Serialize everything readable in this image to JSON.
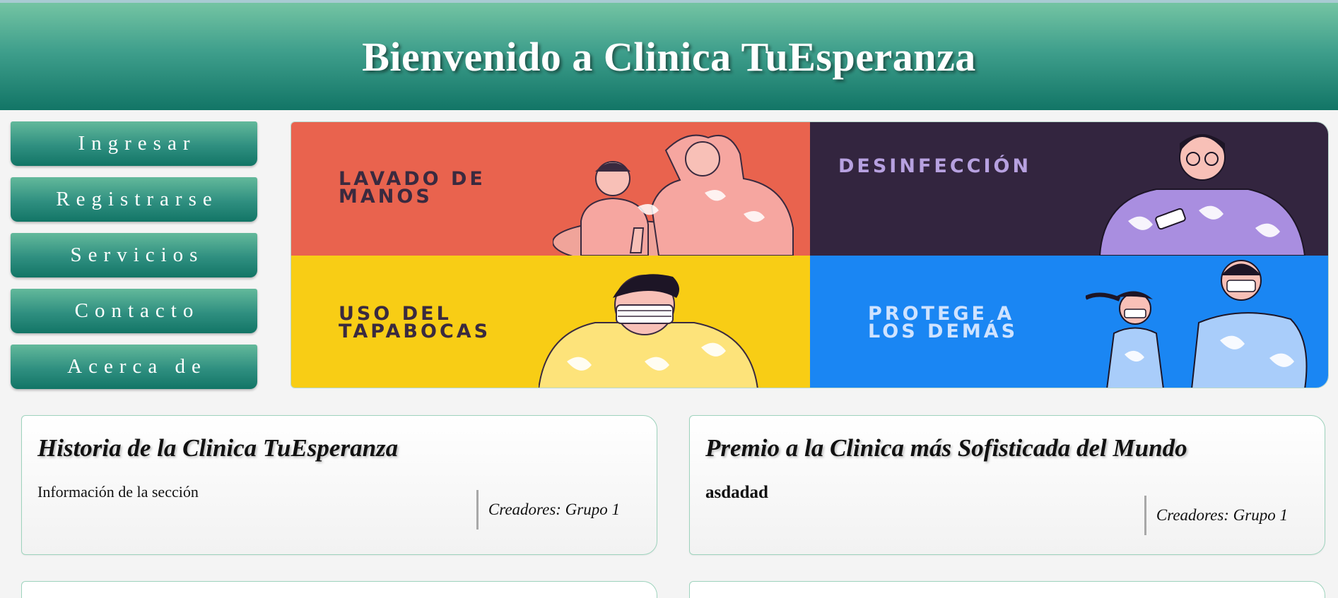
{
  "header": {
    "title": "Bienvenido a Clinica TuEsperanza"
  },
  "nav": {
    "items": [
      {
        "label": "Ingresar"
      },
      {
        "label": "Registrarse"
      },
      {
        "label": "Servicios"
      },
      {
        "label": "Contacto"
      },
      {
        "label": "Acerca de"
      }
    ]
  },
  "banner": {
    "panels": [
      {
        "label": "LAVADO DE\nMANOS",
        "color": "#e9634e",
        "text_color": "#3a2a3f"
      },
      {
        "label": "DESINFECCIÓN",
        "color": "#33253f",
        "text_color": "#b7a1e0"
      },
      {
        "label": "USO DEL\nTAPABOCAS",
        "color": "#f8cd15",
        "text_color": "#3a2a3f"
      },
      {
        "label": "PROTEGE A\nLOS DEMÁS",
        "color": "#1a86f3",
        "text_color": "#cfe3ff"
      }
    ]
  },
  "cards": [
    {
      "title": "Historia de la Clinica TuEsperanza",
      "info": "Información de la sección",
      "credits": "Creadores: Grupo 1"
    },
    {
      "title": "Premio a la Clinica más Sofisticada del Mundo",
      "info": "asdadad",
      "credits": "Creadores: Grupo 1"
    }
  ],
  "colors": {
    "header_top": "#74c4a3",
    "header_bottom": "#127566",
    "card_border": "#9ed3bd"
  }
}
